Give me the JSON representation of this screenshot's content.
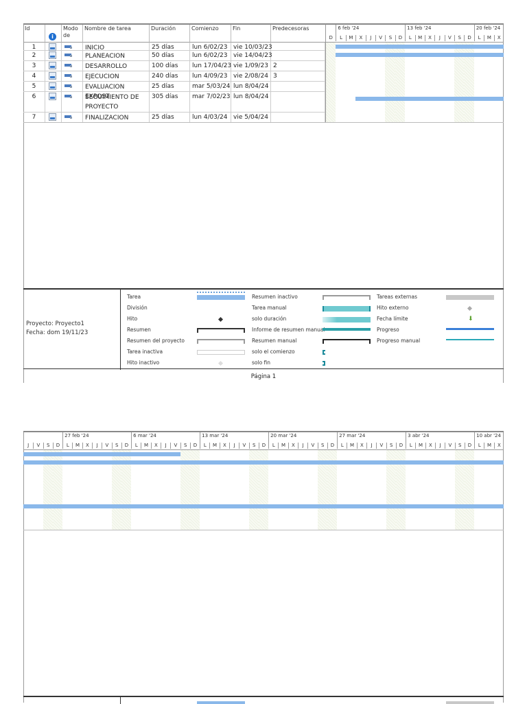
{
  "table": {
    "headers": {
      "id": "Id",
      "info": "i",
      "modo": "Modo de",
      "nombre": "Nombre de tarea",
      "duracion": "Duración",
      "comienzo": "Comienzo",
      "fin": "Fin",
      "pred": "Predecesoras"
    },
    "rows": [
      {
        "id": "1",
        "nombre": "INICIO",
        "duracion": "25 días",
        "comienzo": "lun 6/02/23",
        "fin": "vie 10/03/23",
        "pred": ""
      },
      {
        "id": "2",
        "nombre": "PLANEACION",
        "duracion": "50 días",
        "comienzo": "lun 6/02/23",
        "fin": "vie 14/04/23",
        "pred": ""
      },
      {
        "id": "3",
        "nombre": "DESARROLLO",
        "duracion": "100 días",
        "comienzo": "lun 17/04/23",
        "fin": "vie 1/09/23",
        "pred": "2"
      },
      {
        "id": "4",
        "nombre": "EJECUCION",
        "duracion": "240 días",
        "comienzo": "lun 4/09/23",
        "fin": "vie 2/08/24",
        "pred": "3"
      },
      {
        "id": "5",
        "nombre": "EVALUACION EXPOST",
        "duracion": "25 días",
        "comienzo": "mar 5/03/24",
        "fin": "lun 8/04/24",
        "pred": ""
      },
      {
        "id": "6",
        "nombre": "SEGUIMIENTO DE PROYECTO",
        "duracion": "305 días",
        "comienzo": "mar 7/02/23",
        "fin": "lun 8/04/24",
        "pred": ""
      },
      {
        "id": "7",
        "nombre": "FINALIZACION",
        "duracion": "25 días",
        "comienzo": "lun 4/03/24",
        "fin": "vie 5/04/24",
        "pred": ""
      }
    ]
  },
  "gantt1": {
    "days": [
      "D",
      "L",
      "M",
      "X",
      "J",
      "V",
      "S",
      "D",
      "L",
      "M",
      "X",
      "J",
      "V",
      "S",
      "D",
      "L",
      "M",
      "X"
    ],
    "weeks": [
      {
        "label": "6 feb '24",
        "start": 1
      },
      {
        "label": "13 feb '24",
        "start": 8
      },
      {
        "label": "20 feb '24",
        "start": 15
      }
    ],
    "weekend": [
      0,
      6,
      7,
      13,
      14
    ],
    "bars": [
      {
        "row": 0,
        "start": 1,
        "end": 18
      },
      {
        "row": 1,
        "start": 1,
        "end": 18
      },
      {
        "row": 5,
        "start": 3,
        "end": 18
      }
    ]
  },
  "gantt2": {
    "days": [
      "J",
      "V",
      "S",
      "D",
      "L",
      "M",
      "X",
      "J",
      "V",
      "S",
      "D",
      "L",
      "M",
      "X",
      "J",
      "V",
      "S",
      "D",
      "L",
      "M",
      "X",
      "J",
      "V",
      "S",
      "D",
      "L",
      "M",
      "X",
      "J",
      "V",
      "S",
      "D",
      "L",
      "M",
      "X",
      "J",
      "V",
      "S",
      "D",
      "L",
      "M",
      "X",
      "J",
      "V",
      "S",
      "D",
      "L",
      "M",
      "X"
    ],
    "weeks": [
      {
        "label": "27 feb '24",
        "start": 4
      },
      {
        "label": "6 mar '24",
        "start": 11
      },
      {
        "label": "13 mar '24",
        "start": 18
      },
      {
        "label": "20 mar '24",
        "start": 25
      },
      {
        "label": "27 mar '24",
        "start": 32
      },
      {
        "label": "3 abr '24",
        "start": 39
      },
      {
        "label": "10 abr '24",
        "start": 46
      }
    ],
    "weekend": [
      2,
      3,
      9,
      10,
      16,
      17,
      23,
      24,
      30,
      31,
      37,
      38,
      44,
      45
    ],
    "bars": [
      {
        "row": 0,
        "start": 0,
        "end": 16
      },
      {
        "row": 1,
        "start": 0,
        "end": 49
      },
      {
        "row": 5,
        "start": 0,
        "end": 49
      }
    ]
  },
  "legend": {
    "project": "Proyecto: Proyecto1",
    "date": "Fecha: dom 19/11/23",
    "col1": [
      "Tarea",
      "División",
      "Hito",
      "Resumen",
      "Resumen del proyecto",
      "Tarea inactiva",
      "Hito inactivo"
    ],
    "col2": [
      "Resumen inactivo",
      "Tarea manual",
      "solo duración",
      "Informe de resumen manual",
      "Resumen manual",
      "solo el comienzo",
      "solo fin"
    ],
    "col3": [
      "Tareas externas",
      "Hito externo",
      "Fecha límite",
      "Progreso",
      "Progreso manual"
    ]
  },
  "footer": {
    "page": "Página 1"
  },
  "colors": {
    "bar": "#8ab8ea",
    "manual": "#6fcad0",
    "progress": "#3a7fd8"
  }
}
